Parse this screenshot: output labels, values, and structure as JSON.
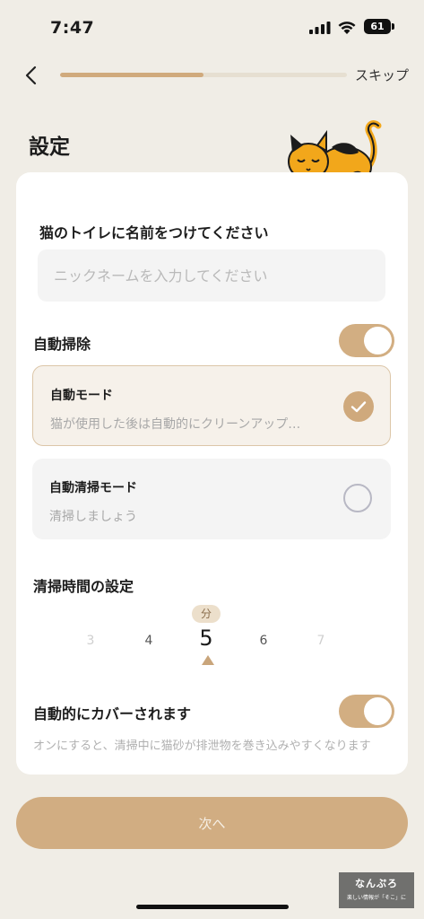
{
  "status_bar": {
    "time": "7:47",
    "battery": "61"
  },
  "nav": {
    "progress_percent": 50,
    "skip_label": "スキップ"
  },
  "page_title": "設定",
  "name_section": {
    "heading": "猫のトイレに名前をつけてください",
    "input_value": "",
    "input_placeholder": "ニックネームを入力してください"
  },
  "auto_clean": {
    "label": "自動掃除",
    "toggle_on": true,
    "modes": [
      {
        "title": "自動モード",
        "description": "猫が使用した後は自動的にクリーンアップ…",
        "selected": true
      },
      {
        "title": "自動清掃モード",
        "description": "清掃しましょう",
        "selected": false
      }
    ]
  },
  "clean_time": {
    "label": "清掃時間の設定",
    "unit": "分",
    "options": [
      "3",
      "4",
      "5",
      "6",
      "7"
    ],
    "selected": "5"
  },
  "auto_cover": {
    "label": "自動的にカバーされます",
    "toggle_on": true,
    "description": "オンにすると、清掃中に猫砂が排泄物を巻き込みやすくなります"
  },
  "next_button": "次へ",
  "watermark": {
    "title": "なんぷろ",
    "subtitle": "楽しい情報が「そこ」に"
  },
  "colors": {
    "accent": "#d1ad82",
    "background": "#f0ede6",
    "card": "#ffffff"
  },
  "icons": [
    "signal-icon",
    "wifi-icon",
    "battery-icon",
    "back-chevron-icon",
    "check-icon",
    "cat-illustration"
  ]
}
